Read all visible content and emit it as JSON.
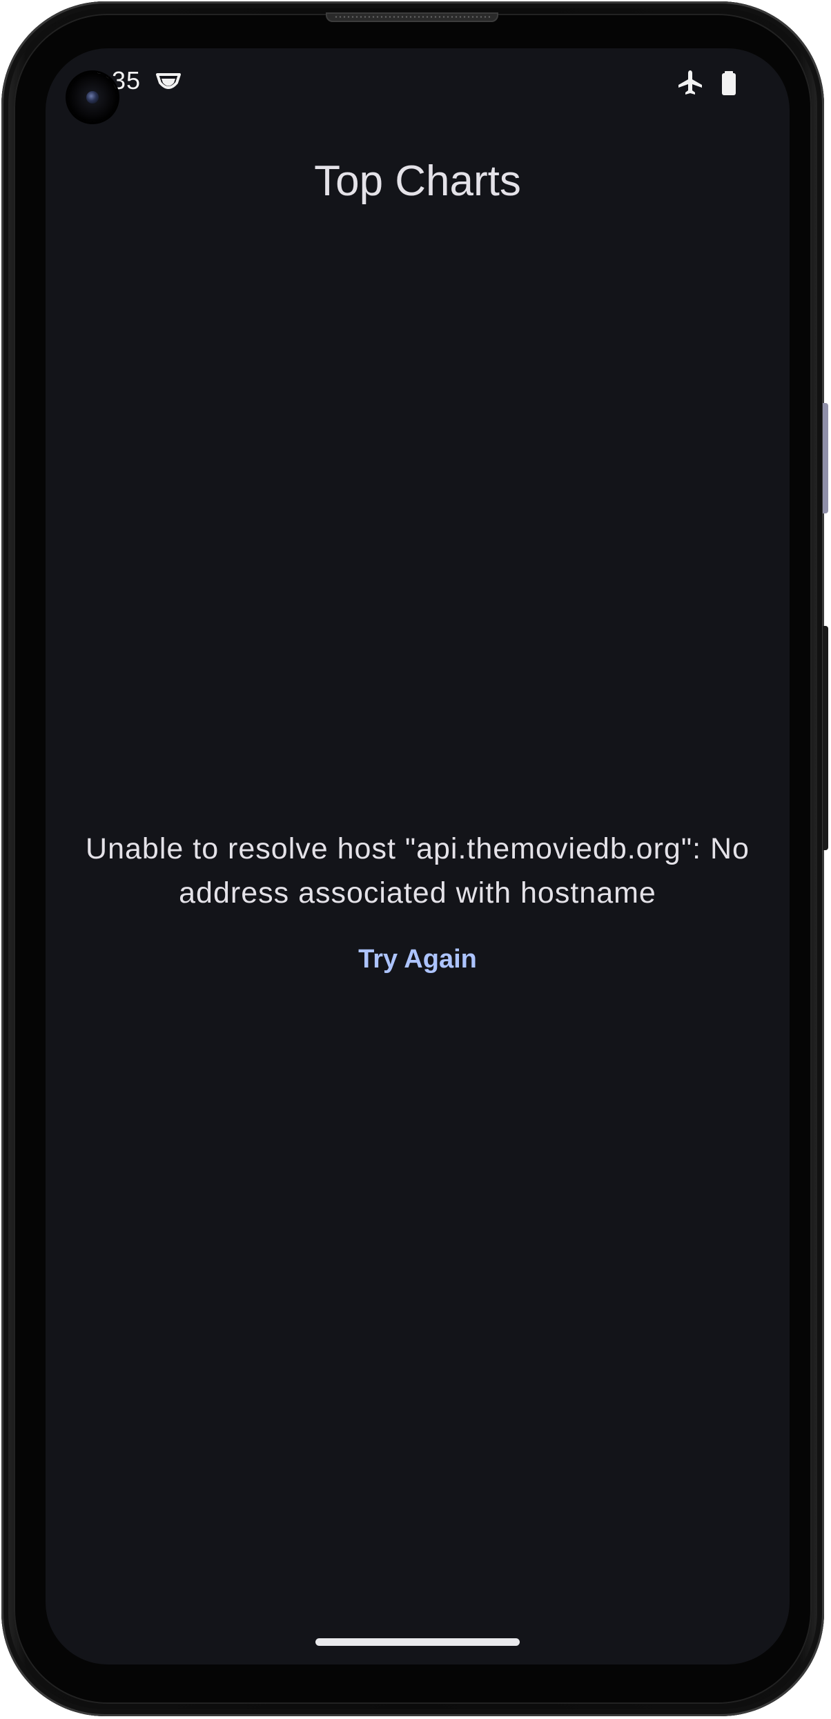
{
  "status_bar": {
    "time": "4:35",
    "icons": [
      "vpn-key-icon",
      "airplane-mode-icon",
      "battery-icon"
    ]
  },
  "app_bar": {
    "title": "Top Charts"
  },
  "error": {
    "message": "Unable to resolve host \"api.themoviedb.org\": No address associated with hostname",
    "retry_label": "Try Again"
  },
  "colors": {
    "background": "#131419",
    "text": "#e4e2e8",
    "accent": "#adc4ff"
  }
}
